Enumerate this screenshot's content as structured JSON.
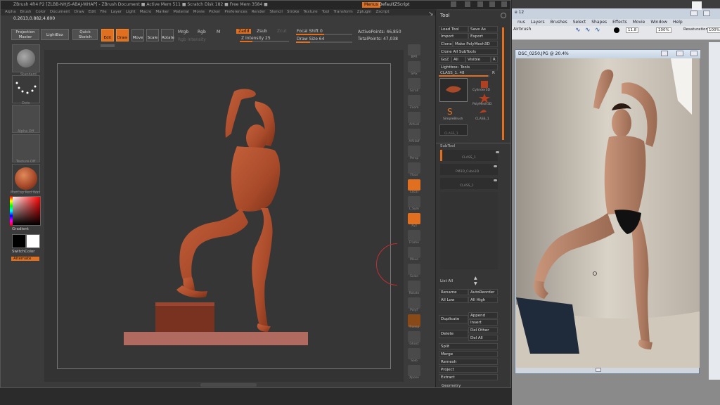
{
  "zbrush": {
    "title": "ZBrush 4R4 P2 [ZLBB-NHJS-ABAJ-WHAP]  - ZBrush Document      ■ Active Mem 511 ■ Scratch Disk 182 ■ Free Mem 3584 ■",
    "menus_btn": "Menus",
    "script_btn": "DefaultZScript",
    "menu": [
      "Alpha",
      "Brush",
      "Color",
      "Document",
      "Draw",
      "Edit",
      "File",
      "Layer",
      "Light",
      "Macro",
      "Marker",
      "Material",
      "Movie",
      "Picker",
      "Preferences",
      "Render",
      "Stencil",
      "Stroke",
      "Texture",
      "Tool",
      "Transform",
      "Zplugin",
      "Zscript"
    ],
    "coords": "0.2613,0.882,4.800",
    "shelf": {
      "projection_master": "Projection Master",
      "lightbox": "LightBox",
      "quick_sketch": "Quick Sketch",
      "edit": "Edit",
      "draw": "Draw",
      "move": "Move",
      "scale": "Scale",
      "rotate": "Rotate",
      "mrgb": "Mrgb",
      "rgb": "Rgb",
      "m": "M",
      "rgb_intensity": "Rgb Intensity",
      "zadd": "Zadd",
      "zsub": "Zsub",
      "zcut": "Zcut",
      "z_intensity": "Z Intensity 25",
      "focal_shift": "Focal Shift 0",
      "draw_size": "Draw Size 64",
      "active_points": "ActivePoints: 46,850",
      "total_points": "TotalPoints: 47,038"
    },
    "left_tray": {
      "tile_labels": [
        "Standard",
        "Dots",
        "Alpha Off",
        "Texture Off",
        "MatCap Red Wax"
      ],
      "gradient": "Gradient",
      "switch_color": "SwitchColor",
      "alternate": "Alternate"
    },
    "right_bar": [
      "BPR",
      "SPix",
      "Scroll",
      "Zoom",
      "Actual",
      "AAHalf",
      "Persp",
      "Floor",
      "Local",
      "L.Sym",
      "Xyz",
      "Frame",
      "Move",
      "Scale",
      "Rotate",
      "PolyF",
      "Transp",
      "Ghost",
      "Solo",
      "Xpose"
    ],
    "tool": {
      "header": "Tool",
      "buttons": [
        [
          "Load Tool",
          "Save As"
        ],
        [
          "Import",
          "Export"
        ]
      ],
      "clone": "Clone",
      "make_polymesh": "Make PolyMesh3D",
      "clone_all": "Clone All SubTools",
      "goz": "GoZ",
      "all": "All",
      "visible": "Visible",
      "r": "R",
      "lightbox_tools": "Lightbox› Tools",
      "current_tool": "CLASS_1. 48",
      "thumbs": [
        "CLASS_1",
        "Cylinder3D",
        "PolyMesh3D",
        "SimpleBrush",
        "CLASS_1",
        "CLASS_1"
      ],
      "subtool_header": "SubTool",
      "subtools": [
        "CLASS_1",
        "PM3D_Cube3D",
        "CLASS_1"
      ],
      "list_all": "List All",
      "rename": "Rename",
      "autoreorder": "AutoReorder",
      "all_low": "All Low",
      "all_high": "All High",
      "append": "Append",
      "duplicate": "Duplicate",
      "insert": "Insert",
      "delete": "Delete",
      "del_other": "Del Other",
      "del_all": "Del All",
      "split": "Split",
      "merge": "Merge",
      "remesh": "Remesh",
      "project": "Project",
      "extract": "Extract",
      "geometry": "Geometry"
    }
  },
  "photoshop": {
    "title_fragment": "e 12",
    "menu": [
      "nus",
      "Layers",
      "Brushes",
      "Select",
      "Shapes",
      "Effects",
      "Movie",
      "Window",
      "Help"
    ],
    "brush_name": "Airbrush",
    "size": "11.8",
    "opacity": "100%",
    "flow": "100%",
    "resaturation": "Resaturation:",
    "resat_val": "100%",
    "doc_title": "DSC_0250.JPG @ 20.4%"
  },
  "colors": {
    "accent": "#e07020",
    "clay": "#a84a2a",
    "panel": "#363636"
  }
}
